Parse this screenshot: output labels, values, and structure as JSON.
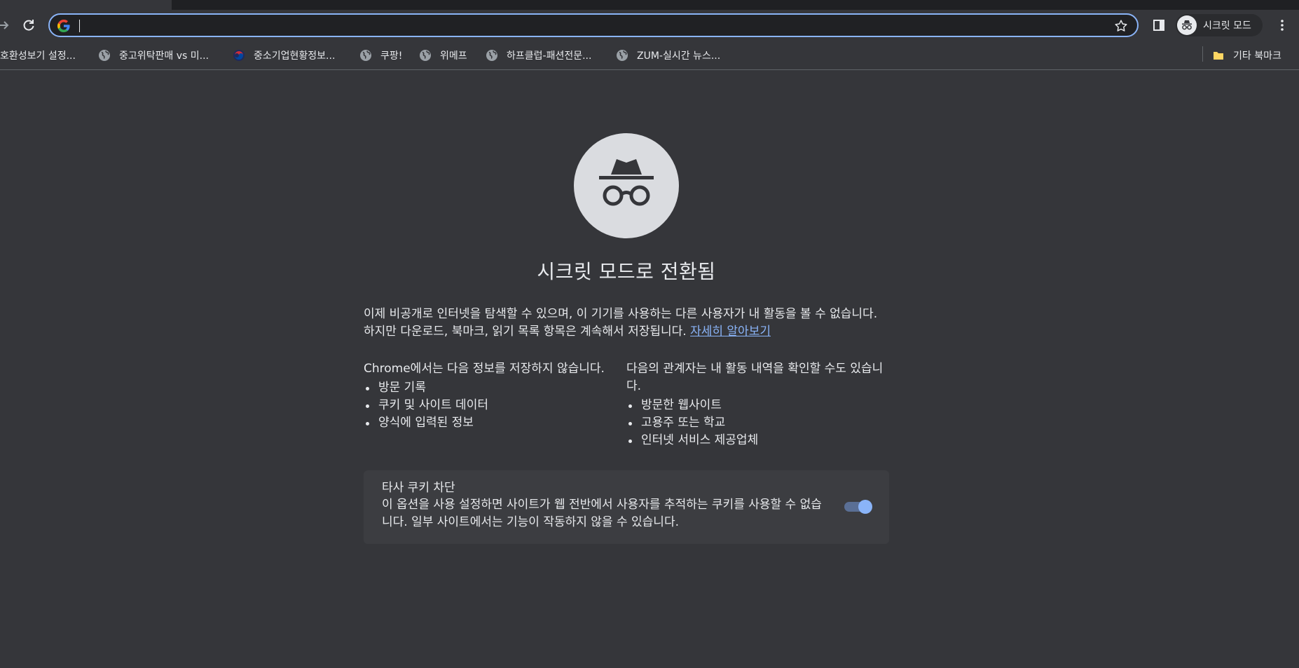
{
  "colors": {
    "background": "#35363a",
    "accent": "#8ab4f8",
    "text": "#e8eaed",
    "card": "#3c3d41"
  },
  "toolbar": {
    "address_value": "",
    "profile_label": "시크릿 모드"
  },
  "bookmarks": {
    "items": [
      {
        "label": "호환성보기 설정...",
        "icon": "globe-icon"
      },
      {
        "label": "중고위탁판매 vs 미...",
        "icon": "globe-icon"
      },
      {
        "label": "중소기업현황정보...",
        "icon": "korea-flag-icon"
      },
      {
        "label": "쿠팡!",
        "icon": "globe-icon"
      },
      {
        "label": "위메프",
        "icon": "globe-icon"
      },
      {
        "label": "하프클럽-패션전문...",
        "icon": "globe-icon"
      },
      {
        "label": "ZUM-실시간 뉴스...",
        "icon": "globe-icon"
      }
    ],
    "other": {
      "label": "기타 북마크",
      "icon": "folder-icon"
    }
  },
  "main": {
    "title": "시크릿 모드로 전환됨",
    "intro": "이제 비공개로 인터넷을 탐색할 수 있으며, 이 기기를 사용하는 다른 사용자가 내 활동을 볼 수 없습니다. 하지만 다운로드, 북마크, 읽기 목록 항목은 계속해서 저장됩니다.",
    "learn_more": "자세히 알아보기",
    "not_saved": {
      "heading": "Chrome에서는 다음 정보를 저장하지 않습니다.",
      "items": [
        "방문 기록",
        "쿠키 및 사이트 데이터",
        "양식에 입력된 정보"
      ]
    },
    "visible_to": {
      "heading": "다음의 관계자는 내 활동 내역을 확인할 수도 있습니다.",
      "items": [
        "방문한 웹사이트",
        "고용주 또는 학교",
        "인터넷 서비스 제공업체"
      ]
    },
    "cookie_card": {
      "title": "타사 쿠키 차단",
      "description": "이 옵션을 사용 설정하면 사이트가 웹 전반에서 사용자를 추적하는 쿠키를 사용할 수 없습니다. 일부 사이트에서는 기능이 작동하지 않을 수 있습니다.",
      "toggle_on": true
    }
  }
}
